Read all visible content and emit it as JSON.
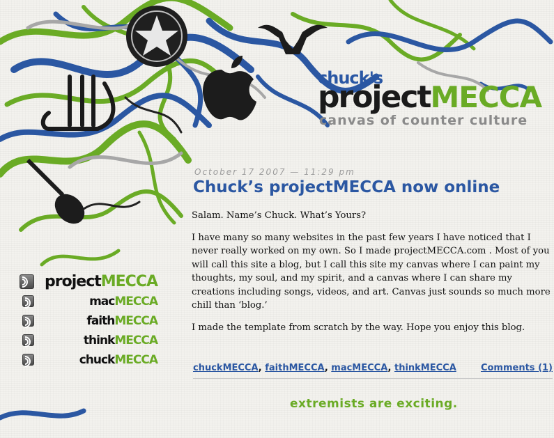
{
  "header": {
    "logo_small": "chuck's",
    "logo_project": "project",
    "logo_mecca": "MECCA",
    "tagline": "canvas of counter culture"
  },
  "sidebar": {
    "items": [
      {
        "prefix": "project",
        "suffix": "MECCA"
      },
      {
        "prefix": "mac",
        "suffix": "MECCA"
      },
      {
        "prefix": "faith",
        "suffix": "MECCA"
      },
      {
        "prefix": "think",
        "suffix": "MECCA"
      },
      {
        "prefix": "chuck",
        "suffix": "MECCA"
      }
    ]
  },
  "post": {
    "date": "October 17 2007 — 11:29 pm",
    "title": "Chuck’s projectMECCA now online",
    "paragraphs": [
      "Salam. Name’s Chuck. What’s Yours?",
      "I have many so many websites in the past few years I have noticed that I never really worked on my own. So I made projectMECCA.com . Most of you will call this site a blog, but I call this site my canvas where I can paint my thoughts, my soul, and my spirit, and a canvas where I can share my creations including songs, videos, and art. Canvas just sounds so much more chill than ‘blog.’",
      "I made the template from scratch by the way. Hope you enjoy this blog."
    ],
    "categories": [
      "chuckMECCA",
      "faithMECCA",
      "macMECCA",
      "thinkMECCA"
    ],
    "comments": "Comments (1)"
  },
  "footer": {
    "tagline": "extremists are exciting."
  },
  "colors": {
    "blue": "#2b57a2",
    "green": "#6aab25",
    "grey": "#8a8a8a"
  },
  "icons": [
    "rss-icon",
    "allah-calligraphy-icon",
    "apple-logo-icon",
    "longhorn-icon",
    "star-seal-icon",
    "guitar-icon"
  ]
}
